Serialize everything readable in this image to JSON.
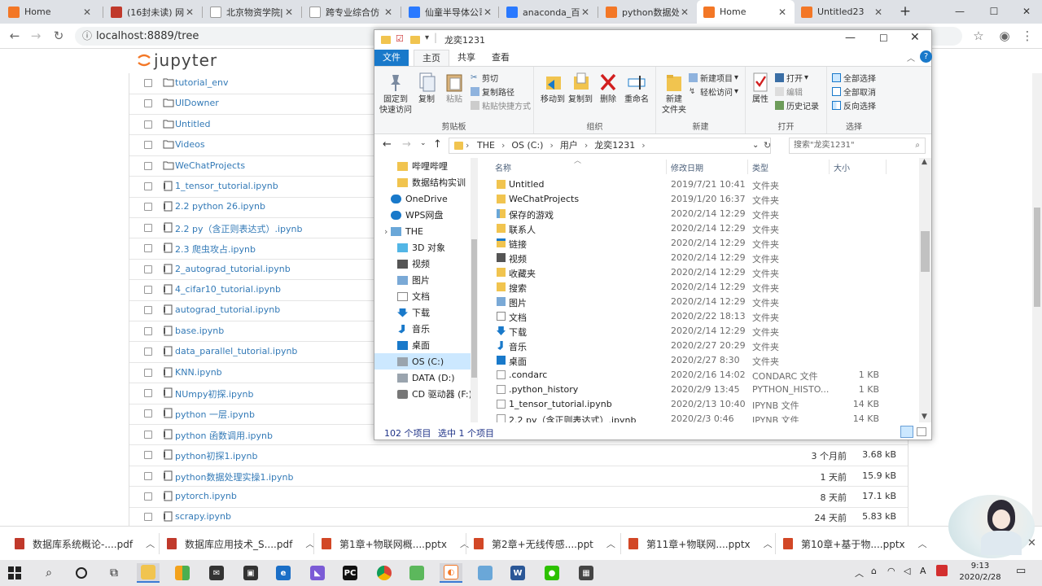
{
  "browser": {
    "tabs": [
      {
        "title": "Home",
        "icon": "jupyter-icon"
      },
      {
        "title": "(16封未读) 网易",
        "icon": "netease-mail-icon"
      },
      {
        "title": "北京物资学院|",
        "icon": "blank-page-icon"
      },
      {
        "title": "跨专业综合仿",
        "icon": "document-icon"
      },
      {
        "title": "仙童半导体公司",
        "icon": "baidu-paw-icon"
      },
      {
        "title": "anaconda_百度",
        "icon": "baidu-paw-icon"
      },
      {
        "title": "python数据处理",
        "icon": "jupyter-notebook-icon"
      },
      {
        "title": "Home",
        "icon": "jupyter-icon"
      },
      {
        "title": "Untitled23",
        "icon": "jupyter-notebook-icon"
      }
    ],
    "active_tab_index": 7,
    "url": "localhost:8889/tree"
  },
  "jupyter": {
    "logo_text": "jupyter",
    "rows": [
      {
        "name": "tutorial_env",
        "type": "folder",
        "modified": "",
        "size": ""
      },
      {
        "name": "UIDowner",
        "type": "folder",
        "modified": "",
        "size": ""
      },
      {
        "name": "Untitled",
        "type": "folder",
        "modified": "",
        "size": ""
      },
      {
        "name": "Videos",
        "type": "folder",
        "modified": "",
        "size": ""
      },
      {
        "name": "WeChatProjects",
        "type": "folder",
        "modified": "",
        "size": ""
      },
      {
        "name": "1_tensor_tutorial.ipynb",
        "type": "notebook",
        "modified": "",
        "size": ""
      },
      {
        "name": "2.2 python 26.ipynb",
        "type": "notebook",
        "modified": "",
        "size": ""
      },
      {
        "name": "2.2 py（含正则表达式）.ipynb",
        "type": "notebook",
        "modified": "",
        "size": ""
      },
      {
        "name": "2.3 爬虫攻占.ipynb",
        "type": "notebook",
        "modified": "",
        "size": ""
      },
      {
        "name": "2_autograd_tutorial.ipynb",
        "type": "notebook",
        "modified": "",
        "size": ""
      },
      {
        "name": "4_cifar10_tutorial.ipynb",
        "type": "notebook",
        "modified": "",
        "size": ""
      },
      {
        "name": "autograd_tutorial.ipynb",
        "type": "notebook",
        "modified": "",
        "size": ""
      },
      {
        "name": "base.ipynb",
        "type": "notebook",
        "modified": "",
        "size": ""
      },
      {
        "name": "data_parallel_tutorial.ipynb",
        "type": "notebook",
        "modified": "",
        "size": ""
      },
      {
        "name": "KNN.ipynb",
        "type": "notebook",
        "modified": "",
        "size": ""
      },
      {
        "name": "NUmpy初探.ipynb",
        "type": "notebook",
        "modified": "",
        "size": ""
      },
      {
        "name": "python 一层.ipynb",
        "type": "notebook",
        "modified": "",
        "size": ""
      },
      {
        "name": "python 函数调用.ipynb",
        "type": "notebook",
        "modified": "",
        "size": ""
      },
      {
        "name": "python初探1.ipynb",
        "type": "notebook",
        "modified": "3 个月前",
        "size": "3.68 kB"
      },
      {
        "name": "python数据处理实操1.ipynb",
        "type": "notebook",
        "modified": "1 天前",
        "size": "15.9 kB"
      },
      {
        "name": "pytorch.ipynb",
        "type": "notebook",
        "modified": "8 天前",
        "size": "17.1 kB"
      },
      {
        "name": "scrapy.ipynb",
        "type": "notebook",
        "modified": "24 天前",
        "size": "5.83 kB"
      }
    ]
  },
  "explorer": {
    "title": "龙奕1231",
    "ribbon_tabs": [
      "文件",
      "主页",
      "共享",
      "查看"
    ],
    "groups": {
      "clipboard": {
        "label": "剪贴板",
        "pin": "固定到\n快速访问",
        "copy": "复制",
        "paste": "粘贴",
        "cut": "剪切",
        "copy_path": "复制路径",
        "paste_shortcut": "粘贴快捷方式"
      },
      "organize": {
        "label": "组织",
        "move_to": "移动到",
        "copy_to": "复制到",
        "delete": "删除",
        "rename": "重命名"
      },
      "new": {
        "label": "新建",
        "new_folder": "新建\n文件夹",
        "new_item": "新建项目",
        "easy_access": "轻松访问"
      },
      "open": {
        "label": "打开",
        "properties": "属性",
        "open": "打开",
        "edit": "编辑",
        "history": "历史记录"
      },
      "select": {
        "label": "选择",
        "select_all": "全部选择",
        "select_none": "全部取消",
        "invert": "反向选择"
      }
    },
    "breadcrumb": [
      "THE",
      "OS (C:)",
      "用户",
      "龙奕1231"
    ],
    "search_placeholder": "搜索\"龙奕1231\"",
    "nav_items": [
      {
        "label": "哔哩哔哩",
        "icon": "folder-icon",
        "indent": 2
      },
      {
        "label": "数据结构实训",
        "icon": "folder-icon",
        "indent": 2
      },
      {
        "label": "OneDrive",
        "icon": "cloud-icon",
        "indent": 1
      },
      {
        "label": "WPS网盘",
        "icon": "cloud-icon",
        "indent": 1
      },
      {
        "label": "THE",
        "icon": "computer-icon",
        "indent": 1
      },
      {
        "label": "3D 对象",
        "icon": "cube-icon",
        "indent": 2
      },
      {
        "label": "视频",
        "icon": "video-icon",
        "indent": 2
      },
      {
        "label": "图片",
        "icon": "picture-icon",
        "indent": 2
      },
      {
        "label": "文档",
        "icon": "document-icon",
        "indent": 2
      },
      {
        "label": "下载",
        "icon": "download-icon",
        "indent": 2
      },
      {
        "label": "音乐",
        "icon": "music-icon",
        "indent": 2
      },
      {
        "label": "桌面",
        "icon": "desktop-icon",
        "indent": 2
      },
      {
        "label": "OS (C:)",
        "icon": "drive-icon",
        "indent": 2,
        "selected": true
      },
      {
        "label": "DATA (D:)",
        "icon": "drive-icon",
        "indent": 2
      },
      {
        "label": "CD 驱动器 (F:)",
        "icon": "cd-drive-icon",
        "indent": 2
      }
    ],
    "columns": [
      "名称",
      "修改日期",
      "类型",
      "大小"
    ],
    "files": [
      {
        "name": "Untitled",
        "date": "2019/7/21 10:41",
        "type": "文件夹",
        "size": "",
        "icon": "folder"
      },
      {
        "name": "WeChatProjects",
        "date": "2019/1/20 16:37",
        "type": "文件夹",
        "size": "",
        "icon": "folder"
      },
      {
        "name": "保存的游戏",
        "date": "2020/2/14 12:29",
        "type": "文件夹",
        "size": "",
        "icon": "games"
      },
      {
        "name": "联系人",
        "date": "2020/2/14 12:29",
        "type": "文件夹",
        "size": "",
        "icon": "folder"
      },
      {
        "name": "链接",
        "date": "2020/2/14 12:29",
        "type": "文件夹",
        "size": "",
        "icon": "links"
      },
      {
        "name": "视频",
        "date": "2020/2/14 12:29",
        "type": "文件夹",
        "size": "",
        "icon": "video"
      },
      {
        "name": "收藏夹",
        "date": "2020/2/14 12:29",
        "type": "文件夹",
        "size": "",
        "icon": "folder"
      },
      {
        "name": "搜索",
        "date": "2020/2/14 12:29",
        "type": "文件夹",
        "size": "",
        "icon": "folder"
      },
      {
        "name": "图片",
        "date": "2020/2/14 12:29",
        "type": "文件夹",
        "size": "",
        "icon": "picture"
      },
      {
        "name": "文档",
        "date": "2020/2/22 18:13",
        "type": "文件夹",
        "size": "",
        "icon": "document"
      },
      {
        "name": "下载",
        "date": "2020/2/14 12:29",
        "type": "文件夹",
        "size": "",
        "icon": "download"
      },
      {
        "name": "音乐",
        "date": "2020/2/27 20:29",
        "type": "文件夹",
        "size": "",
        "icon": "music"
      },
      {
        "name": "桌面",
        "date": "2020/2/27 8:30",
        "type": "文件夹",
        "size": "",
        "icon": "desktop"
      },
      {
        "name": ".condarc",
        "date": "2020/2/16 14:02",
        "type": "CONDARC 文件",
        "size": "1 KB",
        "icon": "file"
      },
      {
        "name": ".python_history",
        "date": "2020/2/9 13:45",
        "type": "PYTHON_HISTO...",
        "size": "1 KB",
        "icon": "file"
      },
      {
        "name": "1_tensor_tutorial.ipynb",
        "date": "2020/2/13 10:40",
        "type": "IPYNB 文件",
        "size": "14 KB",
        "icon": "file"
      },
      {
        "name": "2.2 py（含正则表达式）.ipynb",
        "date": "2020/2/3 0:46",
        "type": "IPYNB 文件",
        "size": "14 KB",
        "icon": "file"
      }
    ],
    "status_count": "102 个项目",
    "status_selected": "选中 1 个项目"
  },
  "downloads": [
    {
      "name": "数据库系统概论-....pdf",
      "kind": "pdf"
    },
    {
      "name": "数据库应用技术_S....pdf",
      "kind": "pdf"
    },
    {
      "name": "第1章+物联网概....pptx",
      "kind": "pptx"
    },
    {
      "name": "第2章+无线传感....ppt",
      "kind": "ppt"
    },
    {
      "name": "第11章+物联网....pptx",
      "kind": "pptx"
    },
    {
      "name": "第10章+基于物....pptx",
      "kind": "pptx"
    }
  ],
  "taskbar": {
    "time": "9:13",
    "date": "2020/2/28"
  },
  "colors": {
    "link": "#337ab7",
    "jupyter_orange": "#f37726",
    "explorer_file_tab": "#1979ca",
    "nav_selected": "#cce8ff"
  }
}
